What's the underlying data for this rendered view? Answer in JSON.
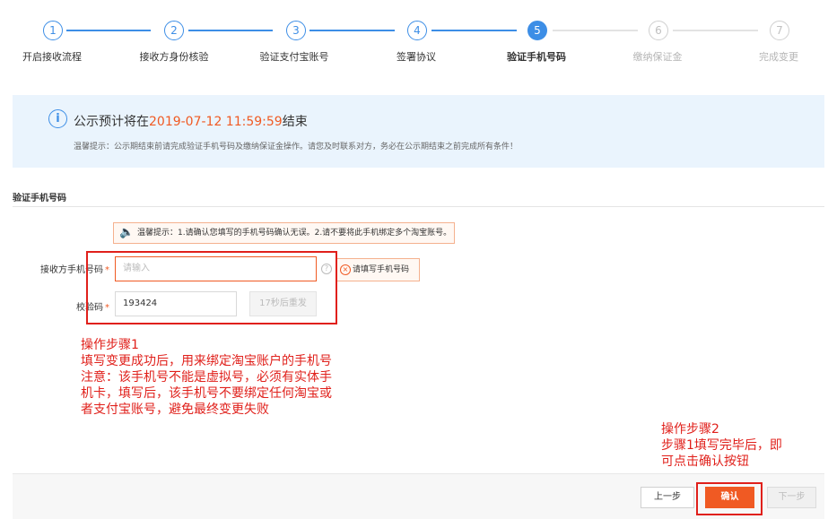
{
  "steps": [
    {
      "num": "1",
      "label": "开启接收流程",
      "state": "done"
    },
    {
      "num": "2",
      "label": "接收方身份核验",
      "state": "done"
    },
    {
      "num": "3",
      "label": "验证支付宝账号",
      "state": "done"
    },
    {
      "num": "4",
      "label": "签署协议",
      "state": "done"
    },
    {
      "num": "5",
      "label": "验证手机号码",
      "state": "active"
    },
    {
      "num": "6",
      "label": "缴纳保证金",
      "state": "todo"
    },
    {
      "num": "7",
      "label": "完成变更",
      "state": "todo"
    }
  ],
  "notice": {
    "prefix": "公示预计将在",
    "datetime": "2019-07-12 11:59:59",
    "suffix": "结束",
    "hint": "温馨提示：公示期结束前请完成验证手机号码及缴纳保证金操作。请您及时联系对方，务必在公示期结束之前完成所有条件！"
  },
  "section": {
    "title": "验证手机号码"
  },
  "tip": "温馨提示：1.请确认您填写的手机号码确认无误。2.请不要将此手机绑定多个淘宝账号。",
  "form": {
    "phone_label": "接收方手机号码",
    "phone_placeholder": "请输入",
    "phone_error": "请填写手机号码",
    "code_label": "校验码",
    "code_value": "193424",
    "resend_label": "17秒后重发",
    "required_mark": "*"
  },
  "annotation1": {
    "line1": "操作步骤1",
    "line2": "填写变更成功后，用来绑定淘宝账户的手机号",
    "line3": "注意：该手机号不能是虚拟号，必须有实体手",
    "line4": "机卡，填写后，该手机号不要绑定任何淘宝或",
    "line5": "者支付宝账号，避免最终变更失败"
  },
  "annotation2": {
    "line1": "操作步骤2",
    "line2": "步骤1填写完毕后，即",
    "line3": "可点击确认按钮"
  },
  "buttons": {
    "prev": "上一步",
    "confirm": "确认",
    "next": "下一步"
  },
  "colors": {
    "primary": "#3d8ee6",
    "accent": "#f05a23",
    "annotation": "#e0201b",
    "notice_bg": "#eaf4fd"
  }
}
